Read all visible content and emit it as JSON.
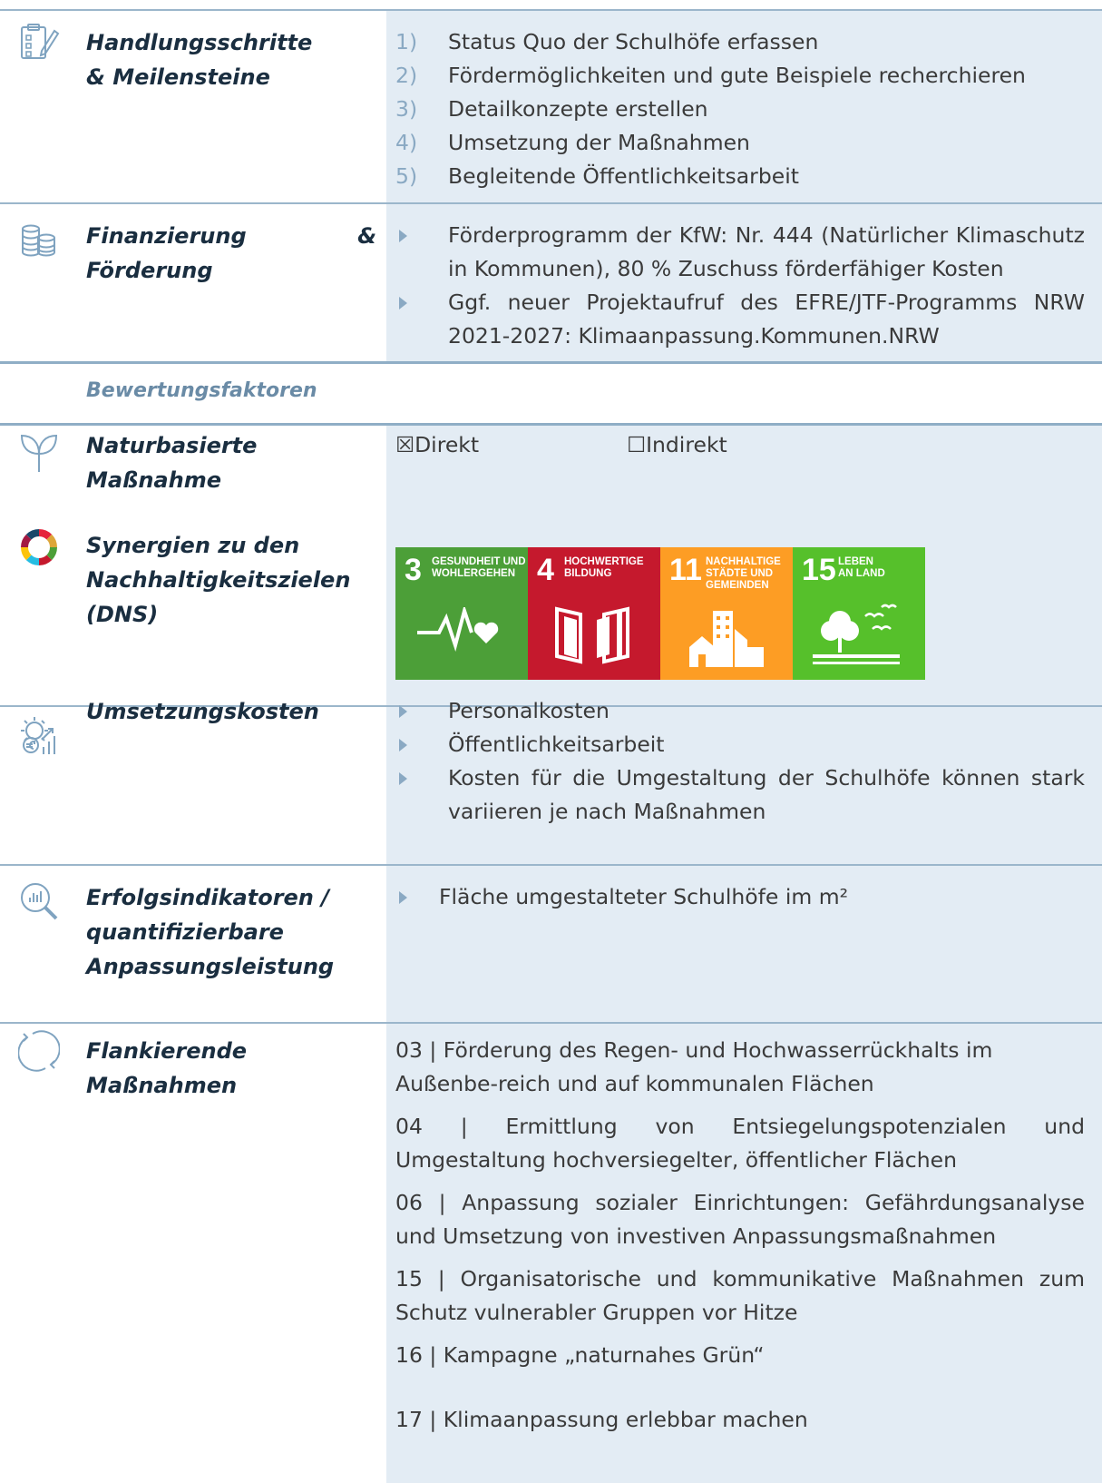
{
  "steps": {
    "label": "Handlungsschritte\n& Meilensteine",
    "items": [
      {
        "num": "1)",
        "text": "Status Quo der Schulhöfe erfassen"
      },
      {
        "num": "2)",
        "text": "Fördermöglichkeiten und gute Beispiele recherchieren"
      },
      {
        "num": "3)",
        "text": "Detailkonzepte erstellen"
      },
      {
        "num": "4)",
        "text": "Umsetzung der Maßnahmen"
      },
      {
        "num": "5)",
        "text": "Begleitende Öffentlichkeitsarbeit"
      }
    ]
  },
  "funding": {
    "label_a": "Finanzierung",
    "label_amp": "&",
    "label_b": "Förderung",
    "items": [
      "Förderprogramm der KfW: Nr. 444 (Natürlicher Klimaschutz in Kommunen), 80 % Zuschuss förderfähiger Kosten",
      "Ggf. neuer Projektaufruf des EFRE/JTF-Programms NRW 2021-2027: Klimaanpassung.Kommunen.NRW"
    ]
  },
  "section_title": "Bewertungsfaktoren",
  "nature": {
    "label": "Naturbasierte\nMaßnahme",
    "direct": "☒Direkt",
    "indirect": "☐Indirekt"
  },
  "synergies": {
    "label": "Synergien zu den\nNachhaltigkeitszielen\n(DNS)",
    "goals": [
      {
        "num": "3",
        "title": "Gesundheit und\nWohlergehen",
        "color": "#4c9f38"
      },
      {
        "num": "4",
        "title": "Hochwertige\nBildung",
        "color": "#c5192d"
      },
      {
        "num": "11",
        "title": "Nachhaltige\nStädte und\nGemeinden",
        "color": "#fd9d24"
      },
      {
        "num": "15",
        "title": "Leben\nan Land",
        "color": "#56c02b"
      }
    ]
  },
  "costs": {
    "label": "Umsetzungskosten",
    "items": [
      "Personalkosten",
      "Öffentlichkeitsarbeit",
      "Kosten für die Umgestaltung der Schulhöfe können stark variieren je nach Maßnahmen"
    ]
  },
  "indicators": {
    "label": "Erfolgsindikatoren /\nquantifizierbare\nAnpassungsleistung",
    "items": [
      "Fläche umgestalteter Schulhöfe im m²"
    ]
  },
  "flanking": {
    "label": "Flankierende\nMaßnahmen",
    "items": [
      "03 | Förderung des Regen- und Hochwasserrückhalts im Außenbe-reich und auf kommunalen Flächen",
      "04 | Ermittlung von Entsiegelungspotenzialen und Umgestaltung hochversiegelter, öffentlicher Flächen",
      "06 | Anpassung sozialer Einrichtungen: Gefährdungsanalyse und Umsetzung von investiven Anpassungsmaßnahmen",
      "15 | Organisatorische und kommunikative Maßnahmen zum Schutz vulnerabler Gruppen vor Hitze",
      "16 | Kampagne „naturnahes Grün“",
      "17 | Klimaanpassung erlebbar machen"
    ]
  },
  "colors": {
    "accent": "#8aa9c3",
    "rowbg": "#e3ecf4",
    "rule": "#8faec6",
    "label": "#1a2e40"
  }
}
